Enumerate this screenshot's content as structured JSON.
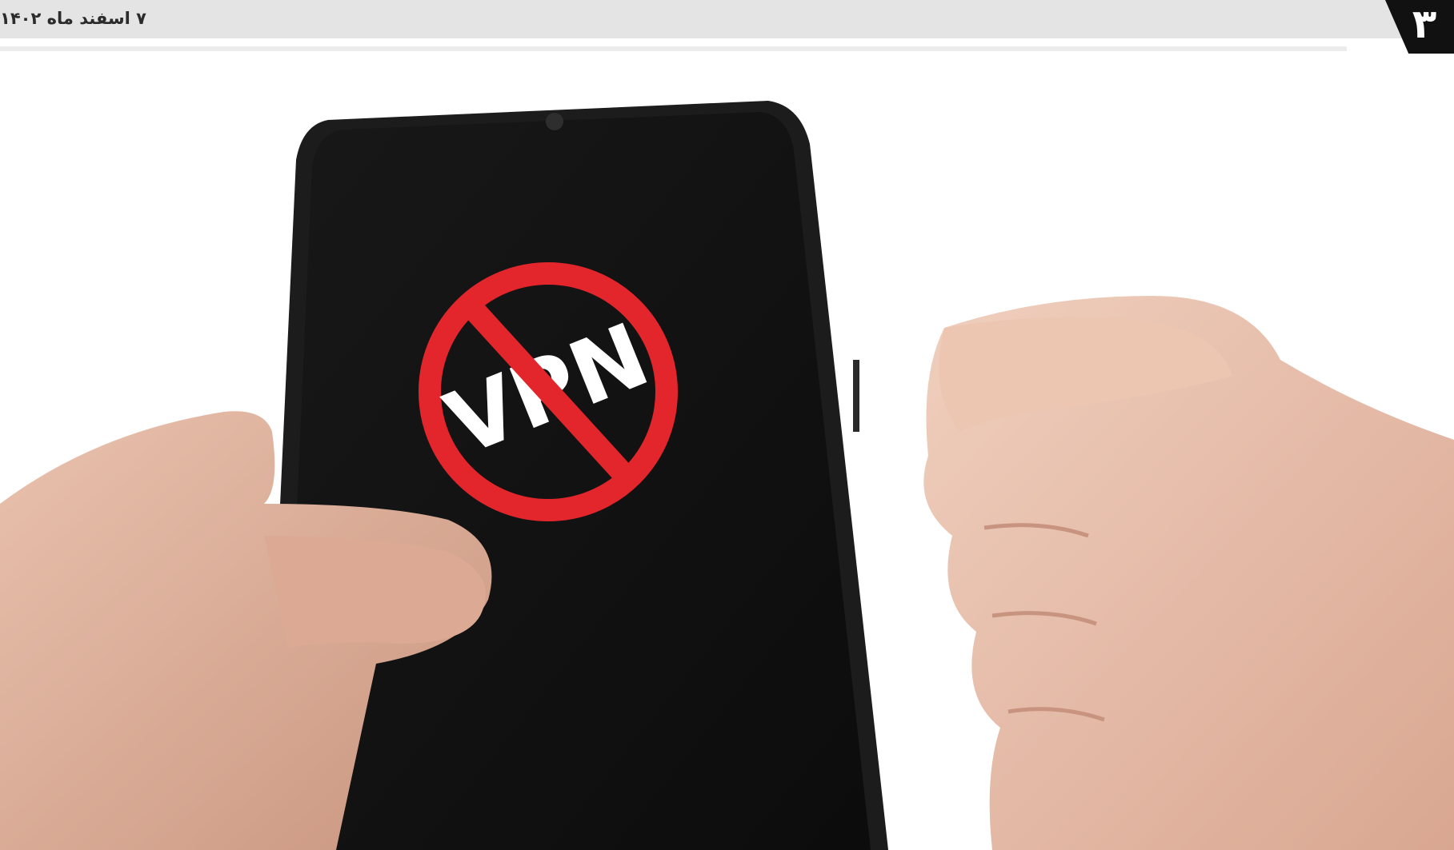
{
  "header": {
    "date": "۷ اسفند ماه ۱۴۰۲",
    "page_number": "۳"
  },
  "photo": {
    "screen_text": "VPN",
    "subject": "hand holding smartphone with crossed-out VPN symbol beside a clenched fist",
    "colors": {
      "screen": "#111111",
      "prohibition": "#e3262b",
      "skin": "#e8bfa9"
    }
  }
}
